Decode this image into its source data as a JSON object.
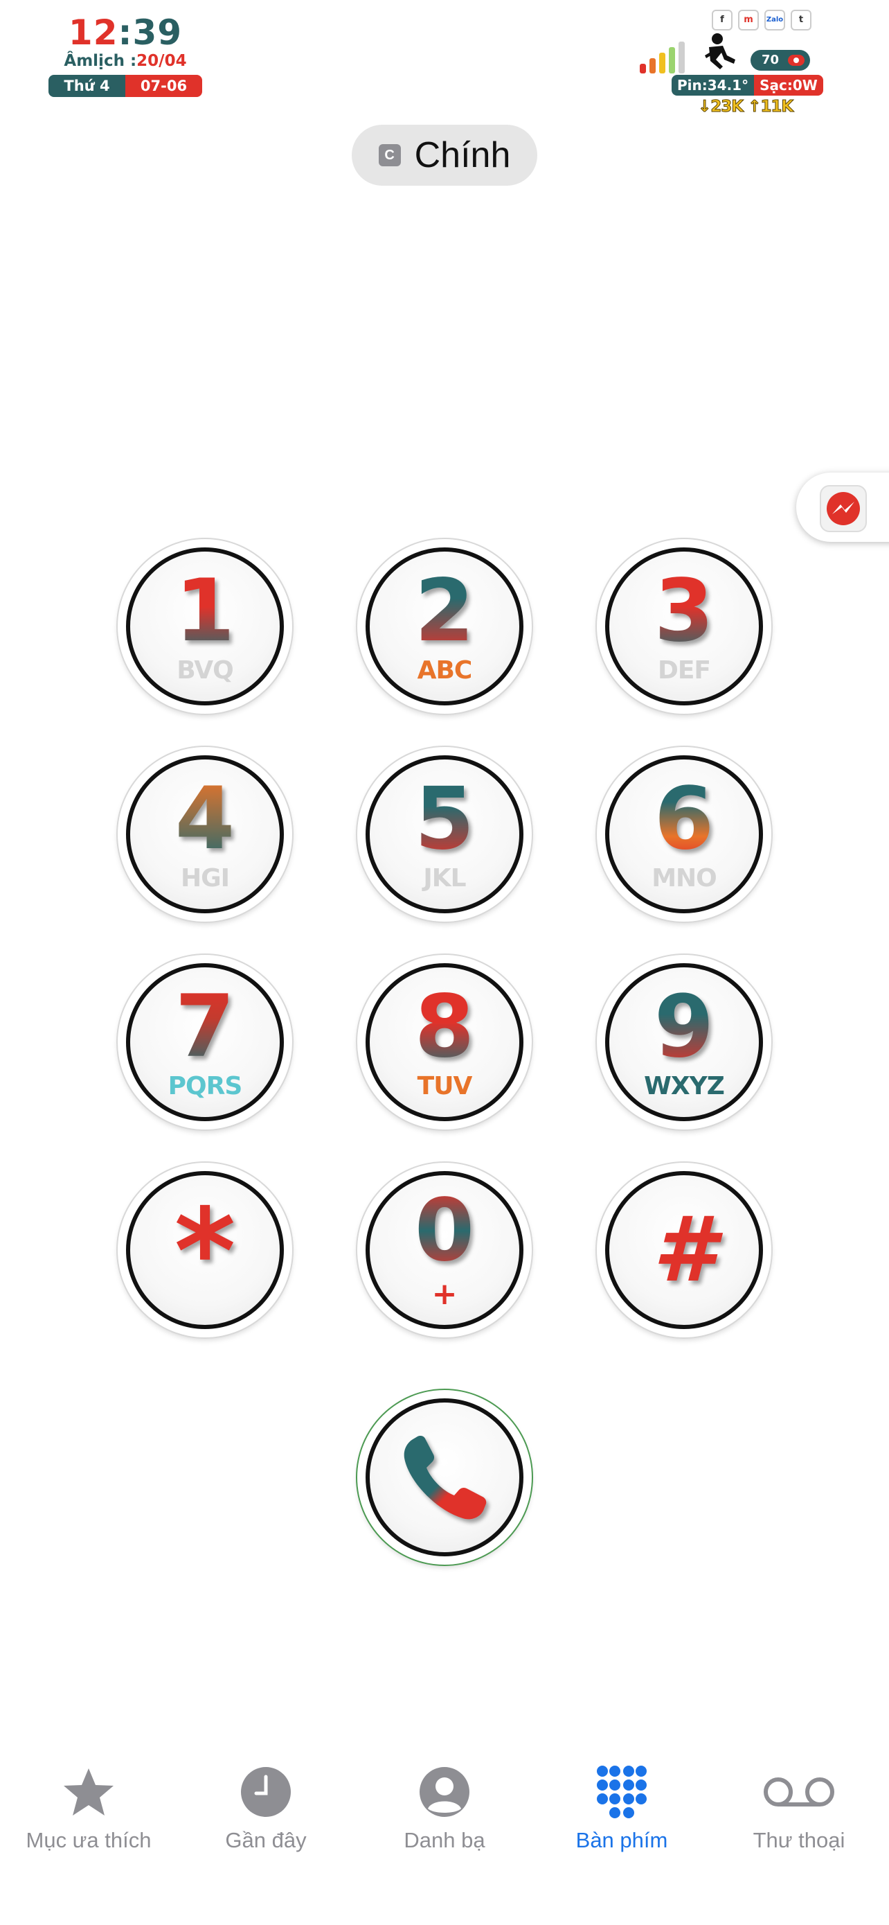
{
  "status_bar": {
    "time_hour": "12",
    "time_colon": ":",
    "time_minute": "39",
    "lunar_label": "Âmlịch :",
    "lunar_date": "20/04",
    "weekday": "Thứ 4",
    "date": "07-06",
    "app_icons": [
      "f",
      "m",
      "Zalo",
      "t"
    ],
    "battery_level": "70",
    "battery_temp": "Pin:34.1°",
    "charge": "Sạc:0W",
    "network_speed": "↓23K ↑11K",
    "colors": {
      "teal": "#2a5f62",
      "red": "#e0322a",
      "yellow": "#f0c020"
    }
  },
  "sim": {
    "badge": "C",
    "label": "Chính"
  },
  "messenger_bubble": {
    "icon": "messenger-icon"
  },
  "keypad": [
    {
      "digit": "1",
      "letters": "BVQ"
    },
    {
      "digit": "2",
      "letters": "ABC"
    },
    {
      "digit": "3",
      "letters": "DEF"
    },
    {
      "digit": "4",
      "letters": "HGI"
    },
    {
      "digit": "5",
      "letters": "JKL"
    },
    {
      "digit": "6",
      "letters": "MNO"
    },
    {
      "digit": "7",
      "letters": "PQRS"
    },
    {
      "digit": "8",
      "letters": "TUV"
    },
    {
      "digit": "9",
      "letters": "WXYZ"
    },
    {
      "digit": "*",
      "letters": ""
    },
    {
      "digit": "0",
      "letters": "+"
    },
    {
      "digit": "#",
      "letters": ""
    }
  ],
  "call_button": {
    "icon": "phone-icon"
  },
  "tabs": [
    {
      "label": "Mục ưa thích",
      "icon": "star-icon",
      "active": false
    },
    {
      "label": "Gần đây",
      "icon": "clock-icon",
      "active": false
    },
    {
      "label": "Danh bạ",
      "icon": "contact-icon",
      "active": false
    },
    {
      "label": "Bàn phím",
      "icon": "keypad-grid-icon",
      "active": true
    },
    {
      "label": "Thư thoại",
      "icon": "voicemail-icon",
      "active": false
    }
  ],
  "accent_color": "#1a73e8",
  "inactive_color": "#8e8e93"
}
